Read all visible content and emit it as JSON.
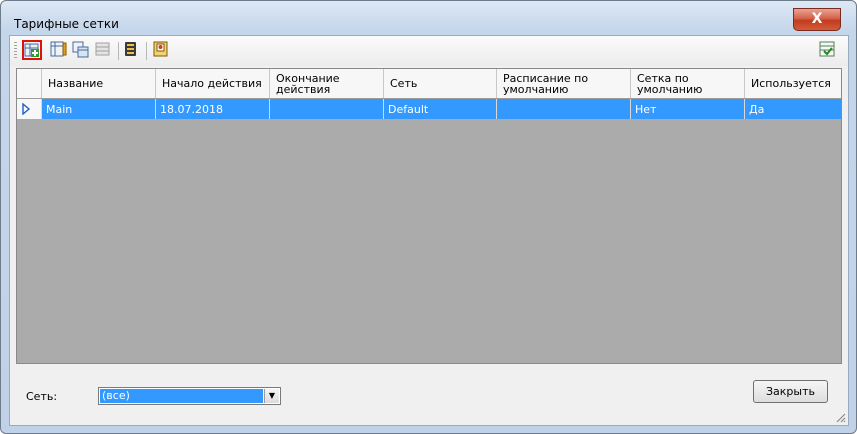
{
  "window": {
    "title": "Тарифные сетки",
    "close_glyph": "X"
  },
  "toolbar": {
    "buttons": [
      {
        "icon": "add-grid-icon",
        "selected": true
      },
      {
        "icon": "edit-grid-icon",
        "selected": false
      },
      {
        "icon": "copy-grid-icon",
        "selected": false
      },
      {
        "icon": "delete-grid-icon",
        "selected": false
      },
      {
        "icon": "barcode-icon",
        "selected": false
      },
      {
        "icon": "card-icon",
        "selected": false
      }
    ],
    "right_icon": "export-excel-icon"
  },
  "table": {
    "columns": [
      "Название",
      "Начало действия",
      "Окончание действия",
      "Сеть",
      "Расписание по умолчанию",
      "Сетка по умолчанию",
      "Используется"
    ],
    "rows": [
      [
        "Main",
        "18.07.2018",
        "",
        "Default",
        "",
        "Нет",
        "Да"
      ]
    ],
    "selected_row_marker": "▶"
  },
  "footer": {
    "network_label": "Сеть:",
    "network_value": "(все)",
    "close_label": "Закрыть"
  },
  "colors": {
    "selection": "#3399ff",
    "grid_background": "#ababab"
  }
}
